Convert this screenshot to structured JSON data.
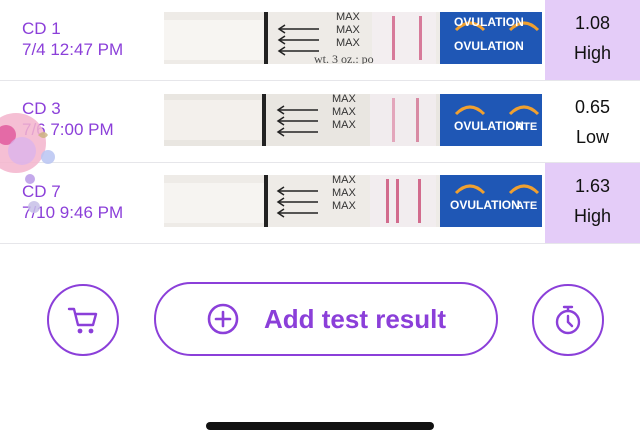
{
  "tests": [
    {
      "day": "CD 1",
      "datetime": "7/4 12:47 PM",
      "value": "1.08",
      "level": "High",
      "highlight": true
    },
    {
      "day": "CD 3",
      "datetime": "7/6 7:00 PM",
      "value": "0.65",
      "level": "Low",
      "highlight": false
    },
    {
      "day": "CD 7",
      "datetime": "7/10 9:46 PM",
      "value": "1.63",
      "level": "High",
      "highlight": true
    }
  ],
  "strip_text": {
    "max": "MAX",
    "brand": "OVULATION",
    "brand_partial": "ATE",
    "packaging": "wt. 3 oz.: po"
  },
  "actions": {
    "add_label": "Add test result",
    "cart_icon": "cart-icon",
    "add_icon": "plus-circle-icon",
    "timer_icon": "stopwatch-icon"
  },
  "colors": {
    "accent": "#8b3fd9",
    "high_highlight": "#e4ccf8",
    "strip_brand_blue": "#1f57b5"
  }
}
